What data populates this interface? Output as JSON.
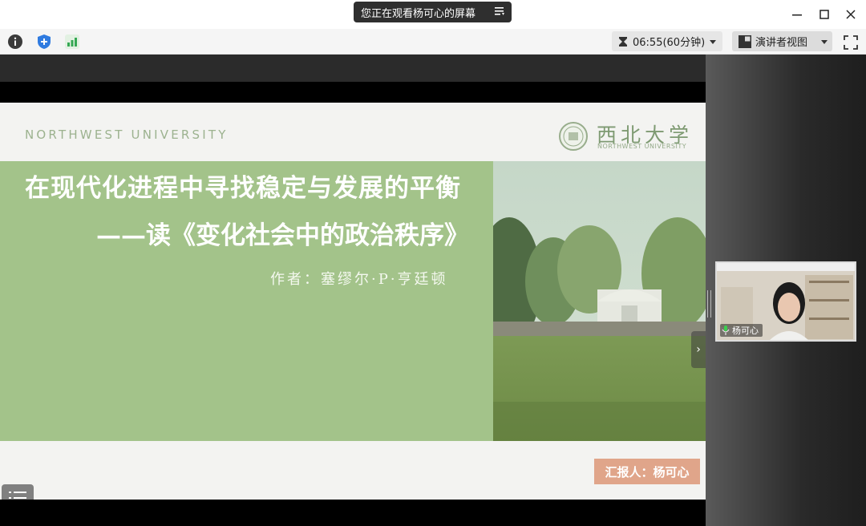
{
  "share_banner": {
    "text": "您正在观看杨可心的屏幕"
  },
  "toolbar": {
    "timer_text": "06:55(60分钟)",
    "view_label": "演讲者视图"
  },
  "slide": {
    "university_en_header": "NORTHWEST UNIVERSITY",
    "logo_cn": "西北大学",
    "logo_en": "NORTHWEST UNIVERSITY",
    "title_line1": "在现代化进程中寻找稳定与发展的平衡",
    "title_line2": "——读《变化社会中的政治秩序》",
    "author": "作者：塞缪尔·P·亨廷顿",
    "reporter": "汇报人：杨可心"
  },
  "participant": {
    "name": "杨可心"
  },
  "colors": {
    "slide_green": "#a3c38a",
    "reporter_badge": "#e0a58a",
    "toolbar_bg": "#f5f5f5",
    "share_banner_bg": "#2f2f2f"
  }
}
